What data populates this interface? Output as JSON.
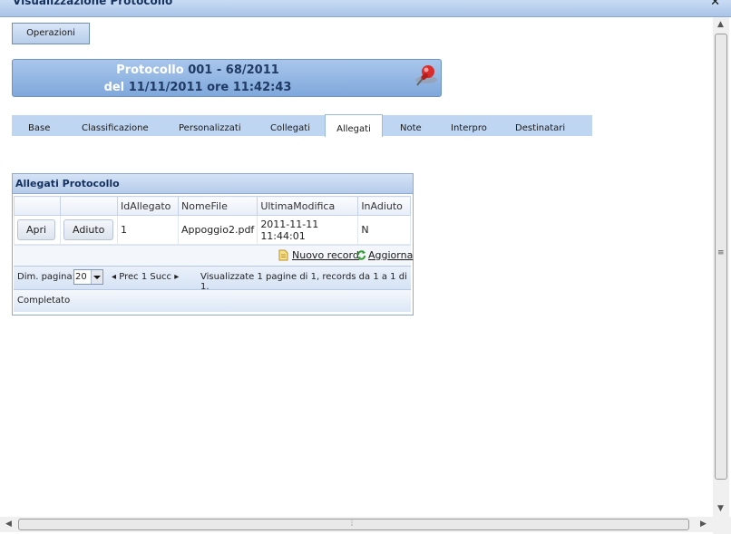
{
  "window": {
    "title": "Visualizzazione Protocollo",
    "close_glyph": "✕"
  },
  "toolbar": {
    "operazioni": "Operazioni"
  },
  "protocol": {
    "label_protocollo": "Protocollo",
    "number": "001 - 68/2011",
    "label_del": "del",
    "datetime": "11/11/2011 ore 11:42:43",
    "icon": "pushpin-icon"
  },
  "tabs": [
    {
      "label": "Base"
    },
    {
      "label": "Classificazione"
    },
    {
      "label": "Personalizzati"
    },
    {
      "label": "Collegati"
    },
    {
      "label": "Allegati",
      "active": true
    },
    {
      "label": "Note"
    },
    {
      "label": "Interpro"
    },
    {
      "label": "Destinatari"
    }
  ],
  "grid": {
    "title": "Allegati Protocollo",
    "columns": [
      "",
      "",
      "IdAllegato",
      "NomeFile",
      "UltimaModifica",
      "InAdiuto"
    ],
    "rows": [
      {
        "btn_open": "Apri",
        "btn_adiuto": "Adiuto",
        "id": "1",
        "file": "Appoggio2.pdf",
        "modified": "2011-11-11 11:44:01",
        "inadiuto": "N"
      }
    ],
    "actions": {
      "new_record": "Nuovo record",
      "refresh": "Aggiorna"
    },
    "pager": {
      "dim_label": "Dim. pagina:",
      "page_size": "20",
      "prev": "Prec",
      "page": "1",
      "next": "Succ",
      "info": "Visualizzate 1 pagine di 1, records da 1 a 1 di 1."
    },
    "status": "Completato"
  },
  "colors": {
    "accent": "#7fa8db",
    "title_text": "#15325f"
  }
}
